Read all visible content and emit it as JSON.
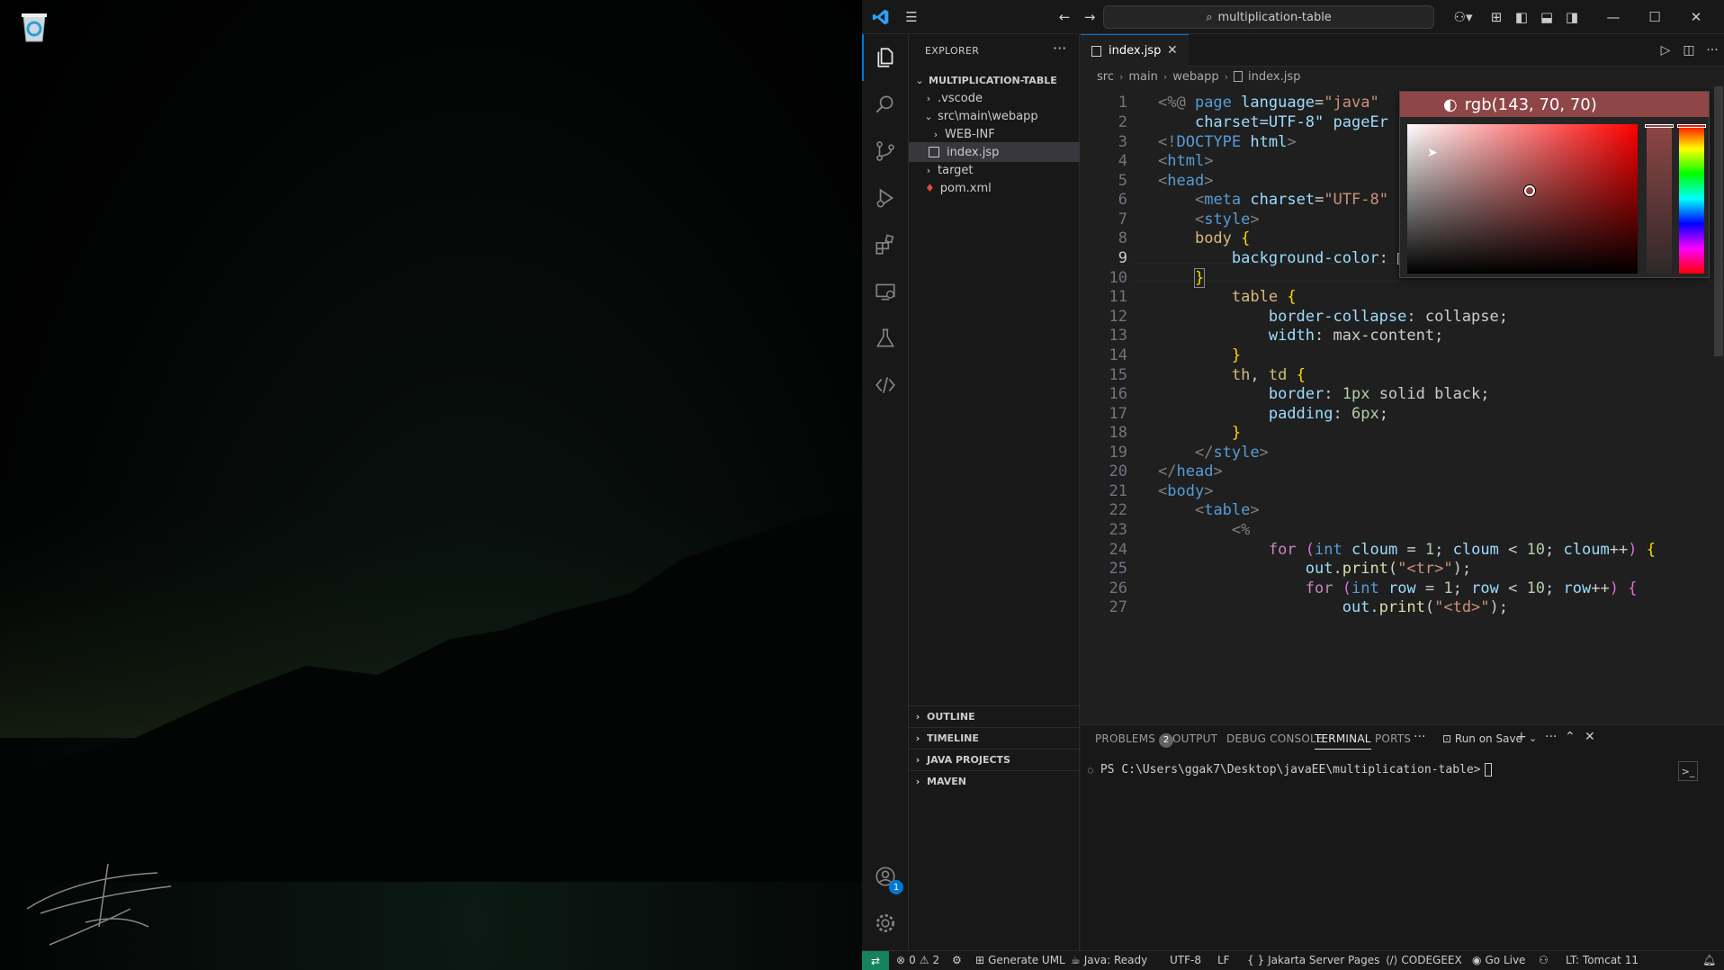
{
  "titlebar": {
    "search_text": "multiplication-table"
  },
  "sidebar": {
    "title": "EXPLORER",
    "project": "MULTIPLICATION-TABLE",
    "tree": [
      {
        "label": ".vscode"
      },
      {
        "label": "src\\main\\webapp"
      },
      {
        "label": "WEB-INF"
      },
      {
        "label": "index.jsp"
      },
      {
        "label": "target"
      },
      {
        "label": "pom.xml"
      }
    ],
    "sections": [
      "OUTLINE",
      "TIMELINE",
      "JAVA PROJECTS",
      "MAVEN"
    ],
    "account_badge": "1"
  },
  "editor": {
    "tab": "index.jsp",
    "breadcrumb": [
      "src",
      "main",
      "webapp",
      "index.jsp"
    ],
    "current_line": 9,
    "line_numbers": [
      "1",
      "2",
      "3",
      "4",
      "5",
      "6",
      "7",
      "8",
      "9",
      "10",
      "11",
      "12",
      "13",
      "14",
      "15",
      "16",
      "17",
      "18",
      "19",
      "20",
      "21",
      "22",
      "23",
      "24",
      "25",
      "26",
      "27"
    ]
  },
  "color_picker": {
    "value": "rgb(143, 70, 70)",
    "color": "#8f4646"
  },
  "panel": {
    "tabs": [
      "PROBLEMS",
      "OUTPUT",
      "DEBUG CONSOLE",
      "TERMINAL",
      "PORTS"
    ],
    "problems_count": "2",
    "active_tab": "TERMINAL",
    "run_on_save": "Run on Save",
    "terminal_prompt": "PS C:\\Users\\ggak7\\Desktop\\javaEE\\multiplication-table>"
  },
  "statusbar": {
    "errors": "0",
    "warnings": "2",
    "generate_uml": "Generate UML",
    "java_status": "Java: Ready",
    "encoding": "UTF-8",
    "eol": "LF",
    "language": "Jakarta Server Pages",
    "codegeex": "CODEGEEX",
    "go_live": "Go Live",
    "tomcat": "LT: Tomcat 11"
  },
  "colors": {
    "accent": "#0078d4",
    "editor_bg": "#1f1f1f",
    "sidebar_bg": "#181818",
    "remote": "#16825d"
  }
}
